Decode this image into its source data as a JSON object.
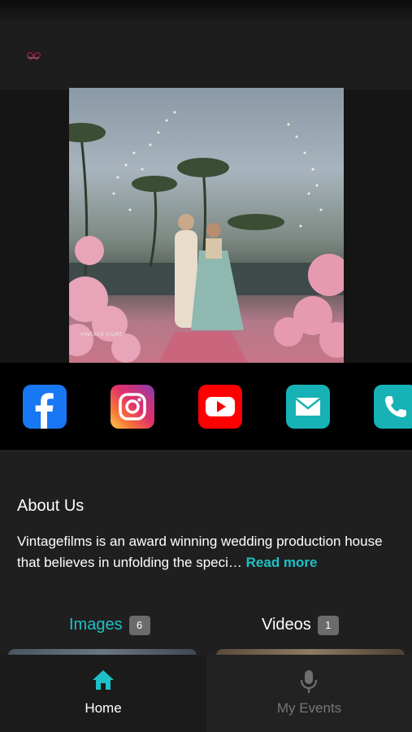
{
  "brand": {
    "logo_text": "VINTAGE"
  },
  "hero": {
    "watermark": "VINTAGE FILMS"
  },
  "social": [
    {
      "name": "facebook",
      "color": "#1877f2",
      "icon": "facebook-icon"
    },
    {
      "name": "instagram",
      "color": "#e1306c",
      "icon": "instagram-icon"
    },
    {
      "name": "youtube",
      "color": "#ff0000",
      "icon": "youtube-icon"
    },
    {
      "name": "email",
      "color": "#17b2b6",
      "icon": "mail-icon"
    },
    {
      "name": "phone",
      "color": "#17b2b6",
      "icon": "phone-icon"
    }
  ],
  "about": {
    "title": "About Us",
    "text": "Vintagefilms is an award winning wedding production house that believes in unfolding the speci…",
    "read_more": "Read more"
  },
  "tabs": [
    {
      "label": "Images",
      "count": "6",
      "active": true
    },
    {
      "label": "Videos",
      "count": "1",
      "active": false
    }
  ],
  "bottom_nav": [
    {
      "label": "Home",
      "icon": "home-icon",
      "active": true
    },
    {
      "label": "My Events",
      "icon": "microphone-icon",
      "active": false
    }
  ],
  "colors": {
    "accent": "#1ec0c7",
    "background": "#1f1f1f"
  }
}
